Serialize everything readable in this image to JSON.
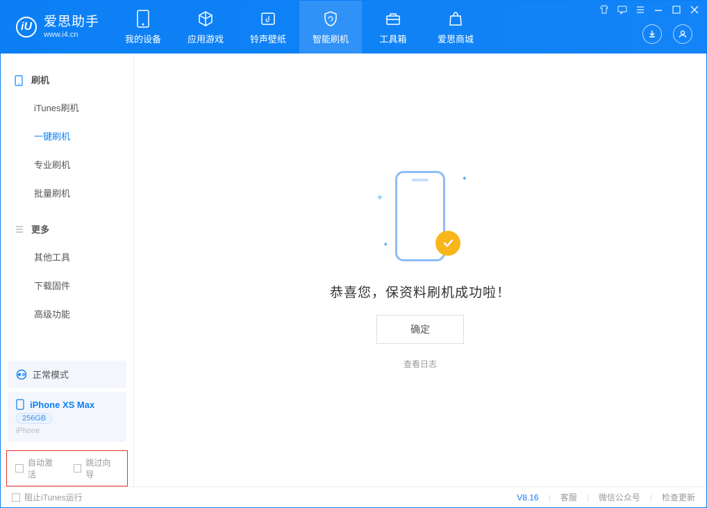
{
  "logo": {
    "title": "爱思助手",
    "subtitle": "www.i4.cn"
  },
  "tabs": [
    {
      "label": "我的设备"
    },
    {
      "label": "应用游戏"
    },
    {
      "label": "铃声壁纸"
    },
    {
      "label": "智能刷机"
    },
    {
      "label": "工具箱"
    },
    {
      "label": "爱思商城"
    }
  ],
  "sidebar": {
    "group1": {
      "title": "刷机",
      "items": [
        "iTunes刷机",
        "一键刷机",
        "专业刷机",
        "批量刷机"
      ]
    },
    "group2": {
      "title": "更多",
      "items": [
        "其他工具",
        "下载固件",
        "高级功能"
      ]
    }
  },
  "device_status": {
    "mode": "正常模式"
  },
  "device": {
    "name": "iPhone XS Max",
    "storage": "256GB",
    "type": "iPhone"
  },
  "options": {
    "auto_activate": "自动激活",
    "skip_guide": "跳过向导"
  },
  "main": {
    "success_text": "恭喜您，保资料刷机成功啦！",
    "confirm": "确定",
    "view_log": "查看日志"
  },
  "footer": {
    "block_itunes": "阻止iTunes运行",
    "version": "V8.16",
    "links": [
      "客服",
      "微信公众号",
      "检查更新"
    ]
  }
}
